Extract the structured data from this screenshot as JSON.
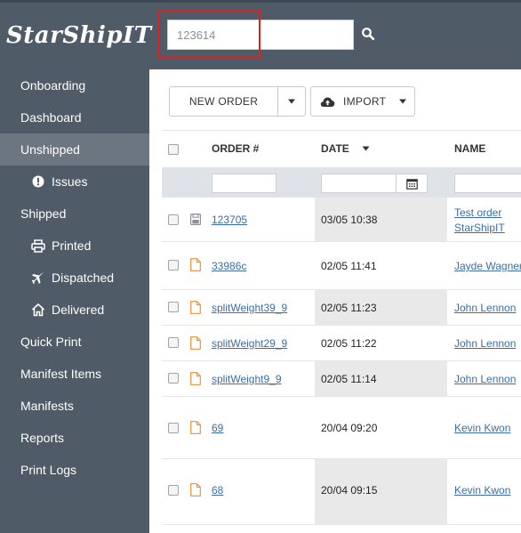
{
  "brand": {
    "logo_text": "StarShipIT",
    "accent": "#f07d3a"
  },
  "search": {
    "value": "123614",
    "placeholder": "123614"
  },
  "sidebar": {
    "items": [
      {
        "label": "Onboarding"
      },
      {
        "label": "Dashboard"
      },
      {
        "label": "Unshipped",
        "active": true
      },
      {
        "label": "Issues",
        "icon": "exclamation-circle-icon"
      },
      {
        "label": "Shipped"
      },
      {
        "label": "Printed",
        "icon": "printer-icon"
      },
      {
        "label": "Dispatched",
        "icon": "plane-icon"
      },
      {
        "label": "Delivered",
        "icon": "home-icon"
      },
      {
        "label": "Quick Print"
      },
      {
        "label": "Manifest Items"
      },
      {
        "label": "Manifests"
      },
      {
        "label": "Reports"
      },
      {
        "label": "Print Logs"
      }
    ]
  },
  "toolbar": {
    "new_order_label": "NEW ORDER",
    "import_label": "IMPORT"
  },
  "table": {
    "columns": {
      "order": "ORDER #",
      "date": "DATE",
      "date_sort": "desc",
      "name": "NAME"
    },
    "rows": [
      {
        "order": "123705",
        "date": "03/05 10:38",
        "name_line1": "Test order",
        "name_line2": "StarShipIT",
        "doc_icon": "save-icon"
      },
      {
        "order": "33986c",
        "date": "02/05 11:41",
        "name_line1": "Jayde Wagner",
        "name_line2": "",
        "doc_icon": "document-icon"
      },
      {
        "order": "splitWeight39_9",
        "date": "02/05 11:23",
        "name_line1": "John Lennon",
        "name_line2": "",
        "doc_icon": "document-icon"
      },
      {
        "order": "splitWeight29_9",
        "date": "02/05 11:22",
        "name_line1": "John Lennon",
        "name_line2": "",
        "doc_icon": "document-icon"
      },
      {
        "order": "splitWeight9_9",
        "date": "02/05 11:14",
        "name_line1": "John Lennon",
        "name_line2": "",
        "doc_icon": "document-icon"
      },
      {
        "order": "69",
        "date": "20/04 09:20",
        "name_line1": "Kevin Kwon",
        "name_line2": "",
        "doc_icon": "document-icon"
      },
      {
        "order": "68",
        "date": "20/04 09:15",
        "name_line1": "Kevin Kwon",
        "name_line2": "",
        "doc_icon": "document-icon"
      }
    ]
  }
}
